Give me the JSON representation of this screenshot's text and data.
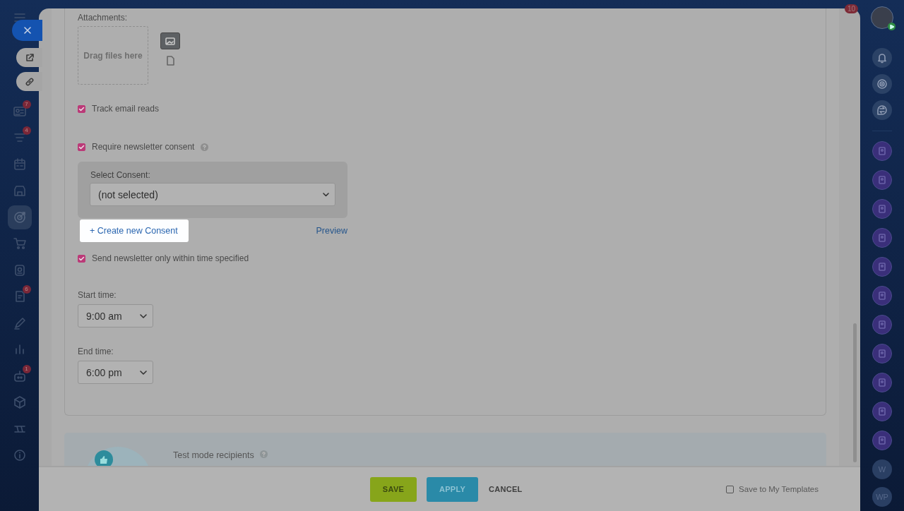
{
  "left_nav": {
    "items": [
      {
        "kind": "card",
        "badge": "7",
        "selected": false
      },
      {
        "kind": "filter",
        "badge": "4",
        "selected": false
      },
      {
        "kind": "calendar",
        "selected": false
      },
      {
        "kind": "store",
        "selected": false
      },
      {
        "kind": "target",
        "selected": true
      },
      {
        "kind": "cart",
        "selected": false
      },
      {
        "kind": "contact",
        "selected": false
      },
      {
        "kind": "tasks",
        "badge": "6",
        "selected": false
      },
      {
        "kind": "pen",
        "selected": false
      },
      {
        "kind": "chart",
        "selected": false
      },
      {
        "kind": "robot",
        "badge": "1",
        "selected": false
      },
      {
        "kind": "box",
        "selected": false
      },
      {
        "kind": "sites",
        "selected": false
      },
      {
        "kind": "info",
        "selected": false
      }
    ]
  },
  "right_nav": {
    "notification_count": "10",
    "contacts": [
      {
        "kind": "contact"
      },
      {
        "kind": "contact"
      },
      {
        "kind": "contact"
      },
      {
        "kind": "contact"
      },
      {
        "kind": "contact"
      },
      {
        "kind": "contact"
      },
      {
        "kind": "contact"
      },
      {
        "kind": "contact"
      },
      {
        "kind": "contact"
      },
      {
        "kind": "contact"
      },
      {
        "kind": "contact"
      },
      {
        "kind": "initials",
        "text": "W"
      },
      {
        "kind": "initials",
        "text": "WP"
      }
    ]
  },
  "form": {
    "attachments_label": "Attachments:",
    "dropzone_text": "Drag files here",
    "track_reads": {
      "label": "Track email reads",
      "checked": true
    },
    "consent": {
      "label": "Require newsletter consent",
      "checked": true,
      "select_label": "Select Consent:",
      "select_value": "(not selected)",
      "create_button": "+ Create new Consent",
      "preview_link": "Preview"
    },
    "time_limit": {
      "label": "Send newsletter only within time specified",
      "checked": true
    },
    "start_time": {
      "label": "Start time:",
      "value": "9:00 am"
    },
    "end_time": {
      "label": "End time:",
      "value": "6:00 pm"
    }
  },
  "test_mode": {
    "label": "Test mode recipients"
  },
  "footer": {
    "buttons": [
      {
        "kind": "save",
        "label": "SAVE"
      },
      {
        "kind": "apply",
        "label": "APPLY"
      },
      {
        "kind": "cancel",
        "label": "CANCEL"
      }
    ],
    "save_template": {
      "label": "Save to My Templates",
      "checked": false
    }
  }
}
